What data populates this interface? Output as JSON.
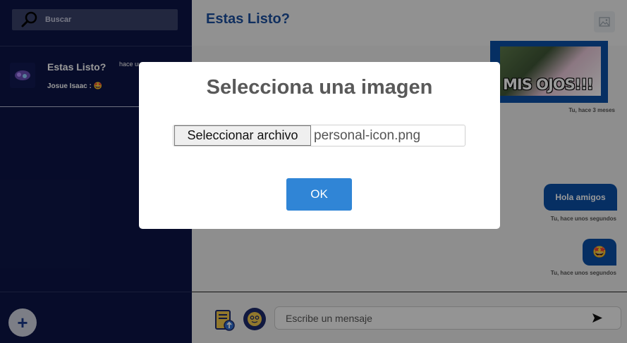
{
  "sidebar": {
    "search_label": "Buscar",
    "chat": {
      "title": "Estas Listo?",
      "time": "hace unos segundos",
      "preview": "Josue Isaac : 🤩"
    },
    "add_label": "+"
  },
  "main": {
    "title": "Estas Listo?",
    "image_caption": "MIS OJOS!!!",
    "messages": [
      {
        "meta": "Tu, hace 3 meses"
      },
      {
        "text": "Hola amigos",
        "meta": "Tu, hace unos segundos"
      },
      {
        "text": "🤩",
        "meta": "Tu, hace unos segundos"
      }
    ],
    "input_placeholder": "Escribe un mensaje"
  },
  "modal": {
    "title": "Selecciona una imagen",
    "file_button": "Seleccionar archivo",
    "file_name": "personal-icon.png",
    "ok_label": "OK"
  },
  "colors": {
    "sidebar_bg": "#0d1547",
    "accent": "#0b4fa6",
    "ok_button": "#3085d6"
  }
}
